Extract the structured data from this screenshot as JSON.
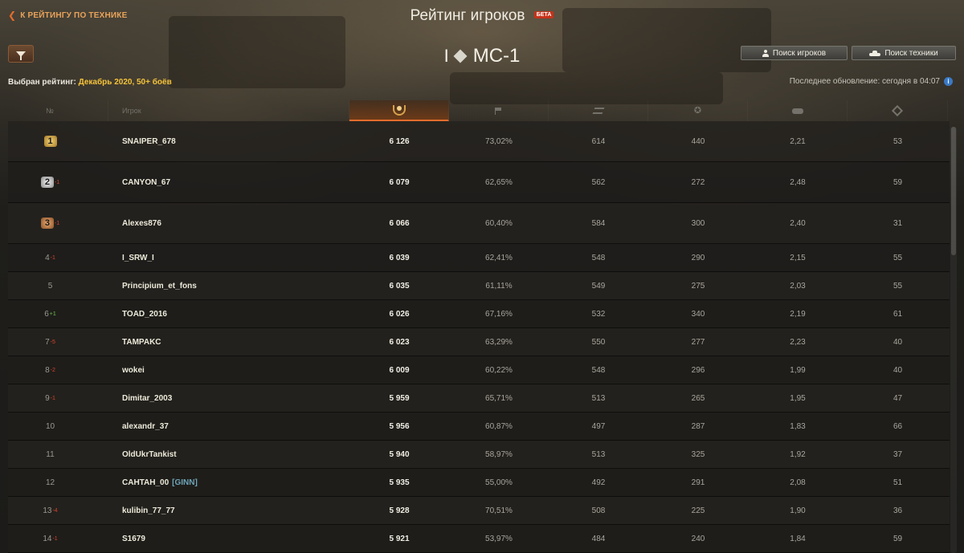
{
  "header": {
    "back_label": "К РЕЙТИНГУ ПО ТЕХНИКЕ",
    "title": "Рейтинг игроков",
    "beta_badge": "БЕТА",
    "vehicle_tier": "I",
    "vehicle_name": "МС-1",
    "search_players_label": "Поиск игроков",
    "search_vehicles_label": "Поиск техники"
  },
  "info": {
    "selected_prefix": "Выбран рейтинг:",
    "selected_value": "Декабрь 2020, 50+ боёв",
    "last_update": "Последнее обновление: сегодня в 04:07"
  },
  "table": {
    "columns": {
      "rank": "№",
      "player": "Игрок"
    },
    "column_icons": [
      "laurel-icon",
      "battles-flag-icon",
      "damage-icon",
      "experience-star-icon",
      "frags-icon",
      "spotting-icon"
    ],
    "rows": [
      {
        "rank": "1",
        "delta": "",
        "player": "SNAIPER_678",
        "clan": "",
        "rating": "6 126",
        "winrate": "73,02%",
        "damage": "614",
        "xp": "440",
        "frags": "2,21",
        "spot": "53"
      },
      {
        "rank": "2",
        "delta": "-1",
        "player": "CANYON_67",
        "clan": "",
        "rating": "6 079",
        "winrate": "62,65%",
        "damage": "562",
        "xp": "272",
        "frags": "2,48",
        "spot": "59"
      },
      {
        "rank": "3",
        "delta": "-1",
        "player": "Alexes876",
        "clan": "",
        "rating": "6 066",
        "winrate": "60,40%",
        "damage": "584",
        "xp": "300",
        "frags": "2,40",
        "spot": "31"
      },
      {
        "rank": "4",
        "delta": "-1",
        "player": "I_SRW_I",
        "clan": "",
        "rating": "6 039",
        "winrate": "62,41%",
        "damage": "548",
        "xp": "290",
        "frags": "2,15",
        "spot": "55"
      },
      {
        "rank": "5",
        "delta": "",
        "player": "Principium_et_fons",
        "clan": "",
        "rating": "6 035",
        "winrate": "61,11%",
        "damage": "549",
        "xp": "275",
        "frags": "2,03",
        "spot": "55"
      },
      {
        "rank": "6",
        "delta": "+1",
        "player": "TOAD_2016",
        "clan": "",
        "rating": "6 026",
        "winrate": "67,16%",
        "damage": "532",
        "xp": "340",
        "frags": "2,19",
        "spot": "61"
      },
      {
        "rank": "7",
        "delta": "-5",
        "player": "TAMPAKC",
        "clan": "",
        "rating": "6 023",
        "winrate": "63,29%",
        "damage": "550",
        "xp": "277",
        "frags": "2,23",
        "spot": "40"
      },
      {
        "rank": "8",
        "delta": "-2",
        "player": "wokei",
        "clan": "",
        "rating": "6 009",
        "winrate": "60,22%",
        "damage": "548",
        "xp": "296",
        "frags": "1,99",
        "spot": "40"
      },
      {
        "rank": "9",
        "delta": "-1",
        "player": "Dimitar_2003",
        "clan": "",
        "rating": "5 959",
        "winrate": "65,71%",
        "damage": "513",
        "xp": "265",
        "frags": "1,95",
        "spot": "47"
      },
      {
        "rank": "10",
        "delta": "",
        "player": "alexandr_37",
        "clan": "",
        "rating": "5 956",
        "winrate": "60,87%",
        "damage": "497",
        "xp": "287",
        "frags": "1,83",
        "spot": "66"
      },
      {
        "rank": "11",
        "delta": "",
        "player": "OldUkrTankist",
        "clan": "",
        "rating": "5 940",
        "winrate": "58,97%",
        "damage": "513",
        "xp": "325",
        "frags": "1,92",
        "spot": "37"
      },
      {
        "rank": "12",
        "delta": "",
        "player": "CAHTAH_00",
        "clan": "[GINN]",
        "rating": "5 935",
        "winrate": "55,00%",
        "damage": "492",
        "xp": "291",
        "frags": "2,08",
        "spot": "51"
      },
      {
        "rank": "13",
        "delta": "-4",
        "player": "kulibin_77_77",
        "clan": "",
        "rating": "5 928",
        "winrate": "70,51%",
        "damage": "508",
        "xp": "225",
        "frags": "1,90",
        "spot": "36"
      },
      {
        "rank": "14",
        "delta": "-1",
        "player": "S1679",
        "clan": "",
        "rating": "5 921",
        "winrate": "53,97%",
        "damage": "484",
        "xp": "240",
        "frags": "1,84",
        "spot": "59"
      }
    ]
  },
  "colors": {
    "accent_orange": "#e46c2c",
    "highlight_yellow": "#f5c33a",
    "delta_up": "#6cc24a",
    "delta_down": "#d9422a",
    "clan_tag": "#6fa5b8"
  }
}
